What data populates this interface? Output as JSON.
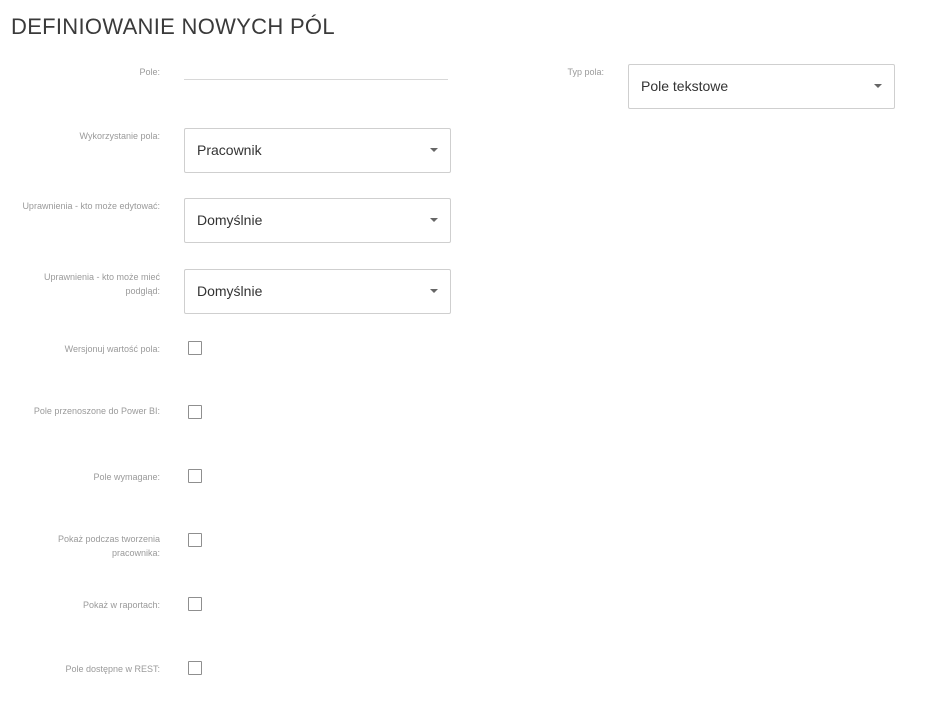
{
  "page": {
    "title": "DEFINIOWANIE NOWYCH PÓL"
  },
  "fields": {
    "pole": {
      "label": "Pole:",
      "value": ""
    },
    "typ_pola": {
      "label": "Typ pola:",
      "value": "Pole tekstowe",
      "icon": "chevron-down-icon"
    },
    "wykorzystanie": {
      "label": "Wykorzystanie pola:",
      "value": "Pracownik",
      "icon": "chevron-down-icon"
    },
    "uprawnienia_edycja": {
      "label": "Uprawnienia - kto może edytować:",
      "value": "Domyślnie",
      "icon": "chevron-down-icon"
    },
    "uprawnienia_podglad": {
      "label": "Uprawnienia - kto może mieć podgląd:",
      "value": "Domyślnie",
      "icon": "chevron-down-icon"
    }
  },
  "checkboxes": {
    "wersjonuj": {
      "label": "Wersjonuj wartość pola:",
      "checked": false
    },
    "power_bi": {
      "label": "Pole przenoszone do Power BI:",
      "checked": false
    },
    "wymagane": {
      "label": "Pole wymagane:",
      "checked": false
    },
    "tworzenie": {
      "label": "Pokaż podczas tworzenia pracownika:",
      "checked": false
    },
    "raporty": {
      "label": "Pokaż w raportach:",
      "checked": false
    },
    "rest": {
      "label": "Pole dostępne w REST:",
      "checked": false
    }
  }
}
